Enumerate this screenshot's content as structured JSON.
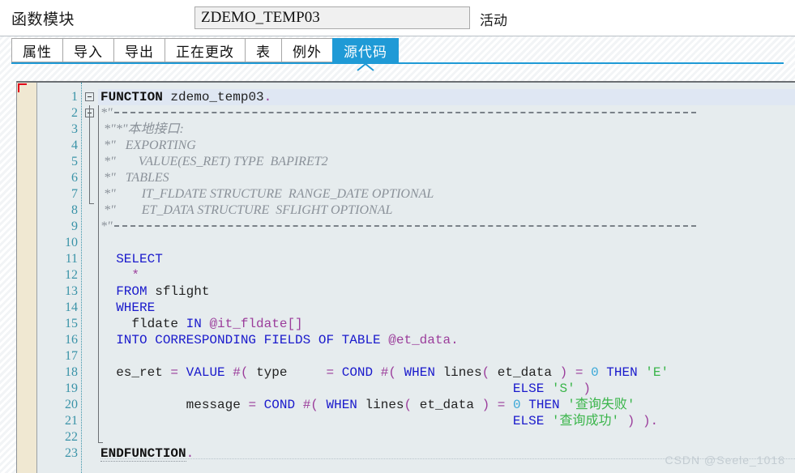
{
  "header": {
    "label": "函数模块",
    "object_name": "ZDEMO_TEMP03",
    "object_name_placeholder": "",
    "status": "活动"
  },
  "tabs": [
    {
      "label": "属性",
      "active": false
    },
    {
      "label": "导入",
      "active": false
    },
    {
      "label": "导出",
      "active": false
    },
    {
      "label": "正在更改",
      "active": false
    },
    {
      "label": "表",
      "active": false
    },
    {
      "label": "例外",
      "active": false
    },
    {
      "label": "源代码",
      "active": true
    }
  ],
  "editor": {
    "current_line": 1,
    "line_numbers": [
      1,
      2,
      3,
      4,
      5,
      6,
      7,
      8,
      9,
      10,
      11,
      12,
      13,
      14,
      15,
      16,
      17,
      18,
      19,
      20,
      21,
      22,
      23
    ],
    "lines": [
      {
        "n": 1,
        "text": "FUNCTION zdemo_temp03."
      },
      {
        "n": 2,
        "text": "*\"----------------------------------------------------------------------"
      },
      {
        "n": 3,
        "text": "*\"*\"本地接口:"
      },
      {
        "n": 4,
        "text": "*\"  EXPORTING"
      },
      {
        "n": 5,
        "text": "*\"     VALUE(ES_RET) TYPE  BAPIRET2"
      },
      {
        "n": 6,
        "text": "*\"  TABLES"
      },
      {
        "n": 7,
        "text": "*\"      IT_FLDATE STRUCTURE  RANGE_DATE OPTIONAL"
      },
      {
        "n": 8,
        "text": "*\"      ET_DATA STRUCTURE  SFLIGHT OPTIONAL"
      },
      {
        "n": 9,
        "text": "*\"----------------------------------------------------------------------"
      },
      {
        "n": 10,
        "text": ""
      },
      {
        "n": 11,
        "text": "  SELECT"
      },
      {
        "n": 12,
        "text": "    *"
      },
      {
        "n": 13,
        "text": "  FROM sflight"
      },
      {
        "n": 14,
        "text": "  WHERE"
      },
      {
        "n": 15,
        "text": "    fldate IN @it_fldate[]"
      },
      {
        "n": 16,
        "text": "  INTO CORRESPONDING FIELDS OF TABLE @et_data."
      },
      {
        "n": 17,
        "text": ""
      },
      {
        "n": 18,
        "text": "  es_ret = VALUE #( type    = COND #( WHEN lines( et_data ) = 0 THEN 'E'"
      },
      {
        "n": 19,
        "text": "                                                       ELSE 'S' )"
      },
      {
        "n": 20,
        "text": "           message = COND #( WHEN lines( et_data ) = 0 THEN '查询失败'"
      },
      {
        "n": 21,
        "text": "                                                       ELSE '查询成功' ) )."
      },
      {
        "n": 22,
        "text": ""
      },
      {
        "n": 23,
        "text": "ENDFUNCTION."
      }
    ],
    "tokens": {
      "function_kw": "FUNCTION",
      "function_name": "zdemo_temp03",
      "dot": ".",
      "comment_prefix": "*\"",
      "comment_local_interface": "*\"*\"本地接口:",
      "comment_exporting": "EXPORTING",
      "comment_value_es_ret": "VALUE(ES_RET) TYPE  BAPIRET2",
      "comment_tables": "TABLES",
      "comment_it_fldate": "IT_FLDATE STRUCTURE  RANGE_DATE OPTIONAL",
      "comment_et_data": "ET_DATA STRUCTURE  SFLIGHT OPTIONAL",
      "select": "SELECT",
      "star": "*",
      "from": "FROM",
      "table_sflight": "sflight",
      "where": "WHERE",
      "field_fldate": "fldate",
      "in": "IN",
      "host_it_fldate": "@it_fldate",
      "brackets": "[]",
      "into_corresponding": "INTO CORRESPONDING FIELDS OF TABLE",
      "host_et_data": "@et_data",
      "var_es_ret": "es_ret",
      "eq": "=",
      "value_kw": "VALUE",
      "hash_open": "#(",
      "field_type": "type",
      "cond_kw": "COND",
      "when_kw": "WHEN",
      "lines_fn": "lines",
      "paren_open": "(",
      "paren_close": ")",
      "var_et_data": "et_data",
      "zero": "0",
      "then_kw": "THEN",
      "else_kw": "ELSE",
      "str_e": "'E'",
      "str_s": "'S'",
      "field_message": "message",
      "str_fail": "'查询失败'",
      "str_success": "'查询成功'",
      "endfunction": "ENDFUNCTION",
      "close_all": ") )."
    }
  },
  "watermark": {
    "text": "CSDN @Seele_1018"
  },
  "colors": {
    "accent": "#1f9ad6",
    "editor_bg": "#e6ecee",
    "current_line": "#dfe7f3",
    "gutter_margin": "#f0e8d2",
    "linenum": "#3a93a8",
    "keyword": "#1a1acc",
    "comment": "#8a9199",
    "string": "#3ab54a",
    "number": "#3aa8d8",
    "operator": "#9b3d9b",
    "breakpoint_marker": "#e2001a"
  }
}
